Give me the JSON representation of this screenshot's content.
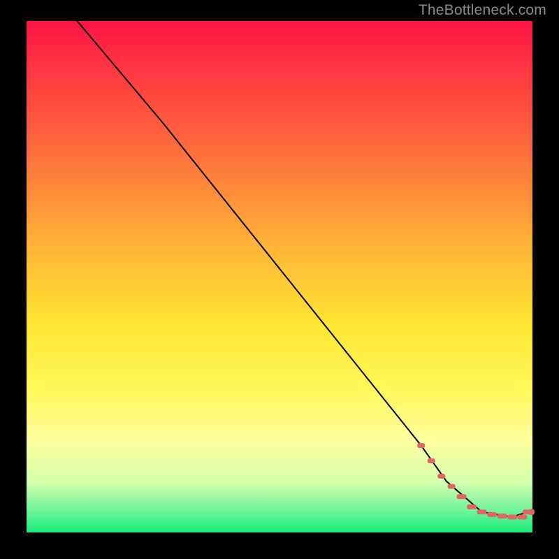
{
  "watermark": "TheBottleneck.com",
  "chart_data": {
    "type": "line",
    "title": "",
    "xlabel": "",
    "ylabel": "",
    "xlim": [
      0,
      100
    ],
    "ylim": [
      0,
      100
    ],
    "series": [
      {
        "name": "primary-curve",
        "x": [
          10,
          27,
          78,
          83,
          90,
          96,
          99
        ],
        "y": [
          100,
          80,
          17,
          10,
          4,
          3,
          4
        ]
      }
    ],
    "marker_segment": {
      "name": "highlight-dots",
      "x": [
        78,
        80,
        82,
        84,
        86,
        88,
        90,
        92,
        94,
        96,
        98,
        99
      ],
      "y": [
        17,
        14,
        11,
        9,
        7,
        5,
        4,
        3.5,
        3.2,
        3,
        3,
        4
      ]
    },
    "background_gradient": [
      "#fb1244",
      "#ffba36",
      "#fff75a",
      "#19eb7b"
    ]
  }
}
